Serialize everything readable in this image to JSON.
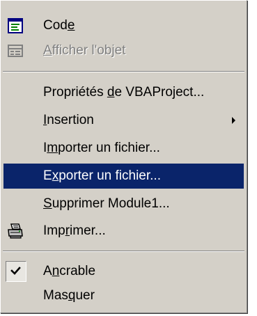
{
  "menu": {
    "items": [
      {
        "name": "code",
        "pre": "Cod",
        "mn": "e",
        "post": "",
        "icon": "code-window-icon",
        "state": "normal"
      },
      {
        "name": "afficher-objet",
        "pre": "",
        "mn": "A",
        "post": "fficher l'objet",
        "icon": "form-object-icon",
        "state": "disabled"
      },
      {
        "name": "proprietes-vbaproject",
        "pre": "Propriétés ",
        "mn": "d",
        "post": "e VBAProject...",
        "state": "normal"
      },
      {
        "name": "insertion",
        "pre": "",
        "mn": "I",
        "post": "nsertion",
        "submenu": true,
        "state": "normal"
      },
      {
        "name": "importer-fichier",
        "pre": "I",
        "mn": "m",
        "post": "porter un fichier...",
        "state": "normal"
      },
      {
        "name": "exporter-fichier",
        "pre": "E",
        "mn": "x",
        "post": "porter un fichier...",
        "state": "highlighted"
      },
      {
        "name": "supprimer-module1",
        "pre": "",
        "mn": "S",
        "post": "upprimer Module1...",
        "state": "normal"
      },
      {
        "name": "imprimer",
        "pre": "Imp",
        "mn": "r",
        "post": "imer...",
        "icon": "printer-icon",
        "state": "normal"
      },
      {
        "name": "ancrable",
        "pre": "A",
        "mn": "n",
        "post": "crable",
        "checked": true,
        "state": "normal"
      },
      {
        "name": "masquer",
        "pre": "Mas",
        "mn": "q",
        "post": "uer",
        "state": "normal"
      }
    ]
  },
  "colors": {
    "menu_background": "#d4d0c8",
    "highlight": "#0a246a",
    "highlight_text": "#ffffff",
    "disabled_text": "#808080"
  }
}
